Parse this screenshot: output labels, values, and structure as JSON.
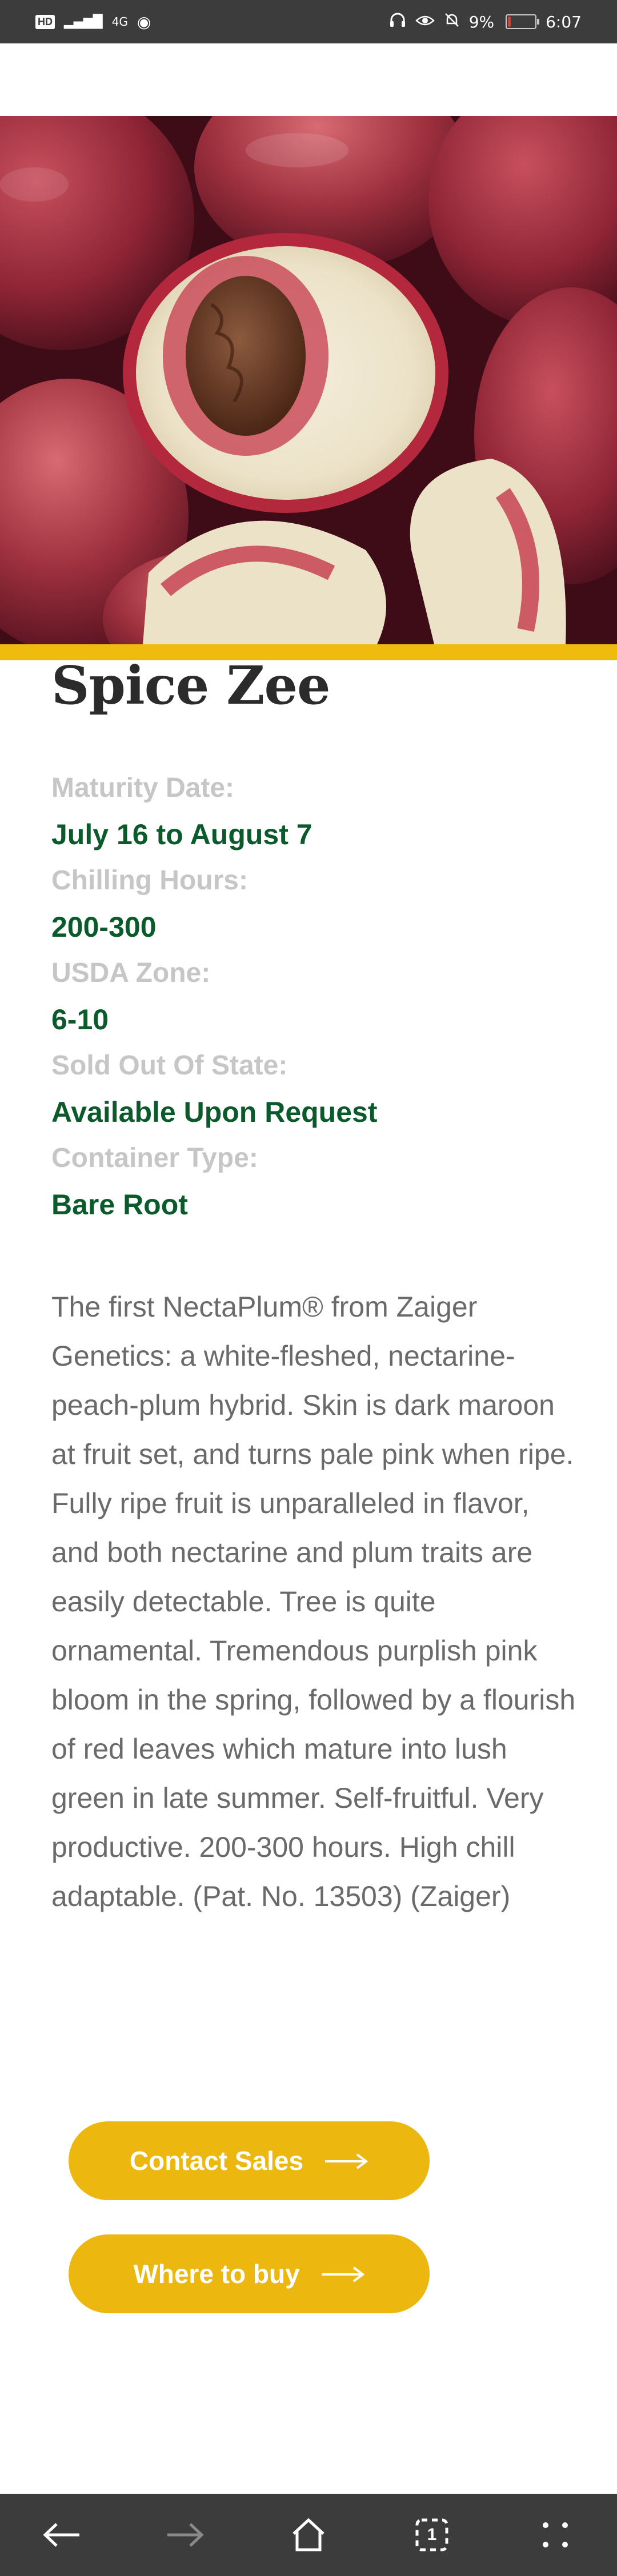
{
  "status_bar": {
    "hd": "HD",
    "signal": "4G",
    "battery": "9%",
    "time": "6:07"
  },
  "product": {
    "title": "Spice Zee",
    "specs": [
      {
        "label": "Maturity Date:",
        "value": "July 16 to August 7"
      },
      {
        "label": "Chilling Hours:",
        "value": "200-300"
      },
      {
        "label": "USDA Zone:",
        "value": "6-10"
      },
      {
        "label": "Sold Out Of State:",
        "value": "Available Upon Request"
      },
      {
        "label": "Container Type:",
        "value": "Bare Root"
      }
    ],
    "description": "The first NectaPlum® from Zaiger Genetics: a white-fleshed, nectarine-peach-plum hybrid. Skin is dark maroon at fruit set, and turns pale pink when ripe. Fully ripe fruit is unparalleled in flavor, and both nectarine and plum traits are easily detectable. Tree is quite ornamental. Tremendous purplish pink bloom in the spring, followed by a flourish of red leaves which mature into lush green in late summer. Self-fruitful. Very productive. 200-300 hours. High chill adaptable. (Pat. No. 13503) (Zaiger)"
  },
  "buttons": {
    "contact_sales": "Contact Sales",
    "where_to_buy": "Where to buy"
  },
  "nav": {
    "tab_count": "1"
  },
  "colors": {
    "accent_yellow": "#ecb70e",
    "value_green": "#0b5a2b",
    "label_gray": "#c6c6c6"
  }
}
